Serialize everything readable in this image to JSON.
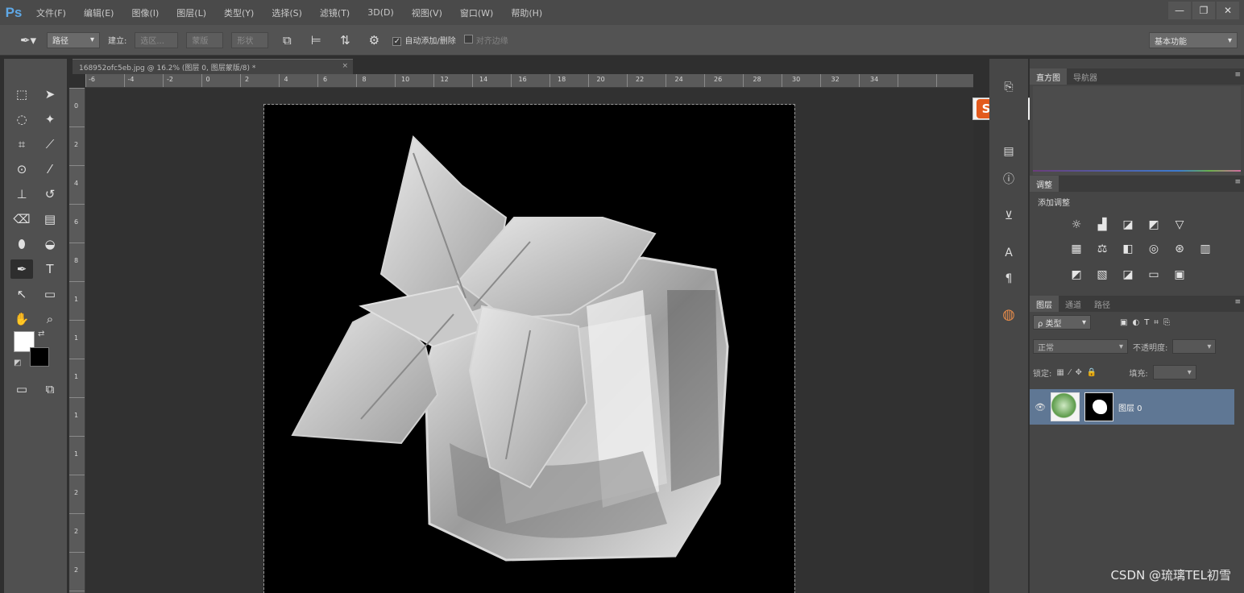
{
  "app": {
    "logo": "Ps",
    "menu": [
      "文件(F)",
      "编辑(E)",
      "图像(I)",
      "图层(L)",
      "类型(Y)",
      "选择(S)",
      "滤镜(T)",
      "3D(D)",
      "视图(V)",
      "窗口(W)",
      "帮助(H)"
    ],
    "window_buttons": [
      "—",
      "❐",
      "✕"
    ]
  },
  "options_bar": {
    "mode_select": "路径",
    "make_label": "建立:",
    "selection_button": "选区...",
    "mask_button": "蒙版",
    "shape_button": "形状",
    "auto_add_delete_label": "自动添加/删除",
    "align_edges_label": "对齐边缘",
    "workspace": "基本功能"
  },
  "document": {
    "tab_title": "168952ofc5eb.jpg @ 16.2% (图层 0, 图层蒙版/8) *",
    "ruler_top_numbers": [
      "-6",
      "-4",
      "-2",
      "0",
      "2",
      "4",
      "6",
      "8",
      "10",
      "12",
      "14",
      "16",
      "18",
      "20",
      "22",
      "24",
      "26",
      "28",
      "30",
      "32",
      "34"
    ],
    "ruler_left_numbers": [
      "0",
      "2",
      "4",
      "6",
      "8",
      "1",
      "1",
      "1",
      "1",
      "1",
      "2",
      "2",
      "2"
    ]
  },
  "panels": {
    "histogram_tabs": [
      "直方图",
      "导航器"
    ],
    "adjustments_tab": "调整",
    "adjustments_title": "添加调整",
    "layers_tabs": [
      "图层",
      "通道",
      "路径"
    ],
    "kind_filter": "ρ 类型",
    "blend_mode": "正常",
    "opacity_label": "不透明度:",
    "lock_label": "锁定:",
    "fill_label": "填充:",
    "layer_name": "图层 0"
  },
  "watermark": "CSDN @琉璃TEL初雪"
}
